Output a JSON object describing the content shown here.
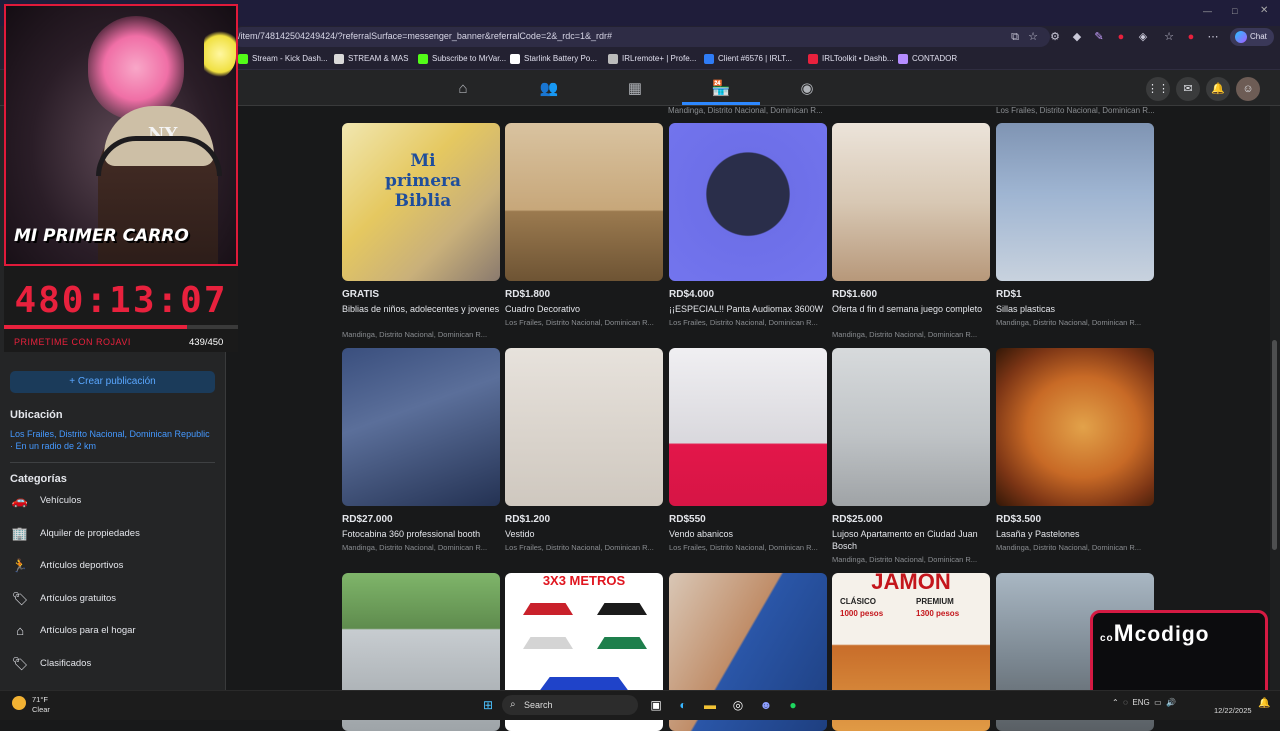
{
  "browser": {
    "url": "/item/748142504249424/?referralSurface=messenger_banner&referralCode=2&_rdc=1&_rdr#",
    "chat_label": "Chat",
    "bookmarks": [
      {
        "label": "Stream - Kick Dash...",
        "color": "#53fc18"
      },
      {
        "label": "STREAM & MAS",
        "color": "#d9d9d9"
      },
      {
        "label": "Subscribe to MrVar...",
        "color": "#53fc18"
      },
      {
        "label": "Starlink Battery Po...",
        "color": "#ffffff"
      },
      {
        "label": "IRLremote+ | Profe...",
        "color": "#bbbbbb"
      },
      {
        "label": "Client #6576 | IRLT...",
        "color": "#2f7cf6"
      },
      {
        "label": "IRLToolkit • Dashb...",
        "color": "#e8213d"
      },
      {
        "label": "CONTADOR",
        "color": "#b58cff"
      }
    ]
  },
  "sidebar": {
    "create_label": "+ Crear publicación",
    "location_title": "Ubicación",
    "location_text": "Los Frailes, Distrito Nacional, Dominican Republic · En un radio de 2 km",
    "categories_title": "Categorías",
    "categories": [
      {
        "label": "Vehículos",
        "icon": "car-icon"
      },
      {
        "label": "Alquiler de propiedades",
        "icon": "building-icon"
      },
      {
        "label": "Artículos deportivos",
        "icon": "running-icon"
      },
      {
        "label": "Artículos gratuitos",
        "icon": "tag-icon"
      },
      {
        "label": "Artículos para el hogar",
        "icon": "home-icon"
      },
      {
        "label": "Clasificados",
        "icon": "tag-icon"
      }
    ]
  },
  "overlay": {
    "car_text": "MI PRIMER CARRO",
    "timer": "480:13:07",
    "sub_label": "PRIMETIME CON ROJAVI",
    "sub_count": "439/450",
    "progress": 0.78,
    "brand": "codigo"
  },
  "top_locations": [
    "Mandinga, Distrito Nacional, Dominican R...",
    "Los Frailes, Distrito Nacional, Dominican R..."
  ],
  "listings": [
    {
      "price": "GRATIS",
      "title": "Biblias de niños, adolecentes y jovenes",
      "location": "Mandinga, Distrito Nacional, Dominican R...",
      "thumb": "t-book",
      "thumb_text": "Mi primera Biblia"
    },
    {
      "price": "RD$1.800",
      "title": "Cuadro Decorativo",
      "location": "Los Frailes, Distrito Nacional, Dominican R...",
      "thumb": "t-wolf",
      "thumb_text": ""
    },
    {
      "price": "RD$4.000",
      "title": "¡¡ESPECIAL!! Panta Audiomax 3600W",
      "location": "Los Frailes, Distrito Nacional, Dominican R...",
      "thumb": "t-amp",
      "thumb_text": ""
    },
    {
      "price": "RD$1.600",
      "title": "Oferta d fin d semana juego completo",
      "location": "Mandinga, Distrito Nacional, Dominican R...",
      "thumb": "t-shelf",
      "thumb_text": ""
    },
    {
      "price": "RD$1",
      "title": "Sillas plasticas",
      "location": "Mandinga, Distrito Nacional, Dominican R...",
      "thumb": "t-chairs",
      "thumb_text": ""
    },
    {
      "price": "RD$27.000",
      "title": "Fotocabina 360 professional booth",
      "location": "Mandinga, Distrito Nacional, Dominican R...",
      "thumb": "t-scooter",
      "thumb_text": ""
    },
    {
      "price": "RD$1.200",
      "title": "Vestido",
      "location": "Los Frailes, Distrito Nacional, Dominican R...",
      "thumb": "t-dress",
      "thumb_text": ""
    },
    {
      "price": "RD$550",
      "title": "Vendo abanicos",
      "location": "Los Frailes, Distrito Nacional, Dominican R...",
      "thumb": "t-proj",
      "thumb_text": ""
    },
    {
      "price": "RD$25.000",
      "title": "Lujoso Apartamento en Ciudad Juan Bosch",
      "location": "Mandinga, Distrito Nacional, Dominican R...",
      "thumb": "t-apt",
      "thumb_text": ""
    },
    {
      "price": "RD$3.500",
      "title": "Lasaña y Pastelones",
      "location": "Mandinga, Distrito Nacional, Dominican R...",
      "thumb": "t-lasagna",
      "thumb_text": ""
    },
    {
      "price": "",
      "title": "",
      "location": "",
      "thumb": "t-car",
      "thumb_text": ""
    },
    {
      "price": "",
      "title": "",
      "location": "",
      "thumb": "t-tents",
      "thumb_text": "3X3 METROS"
    },
    {
      "price": "",
      "title": "",
      "location": "",
      "thumb": "t-phone",
      "thumb_text": ""
    },
    {
      "price": "",
      "title": "",
      "location": "",
      "thumb": "t-jamon",
      "thumb_text": "JAMON"
    },
    {
      "price": "",
      "title": "",
      "location": "",
      "thumb": "t-promo",
      "thumb_text": ""
    }
  ],
  "jamon": {
    "left_title": "CLÁSICO",
    "left_price": "1000 pesos",
    "right_title": "PREMIUM",
    "right_price": "1300 pesos"
  },
  "taskbar": {
    "weather_temp": "71°F",
    "weather_desc": "Clear",
    "search_label": "Search",
    "lang": "ENG",
    "date": "12/22/2025"
  }
}
